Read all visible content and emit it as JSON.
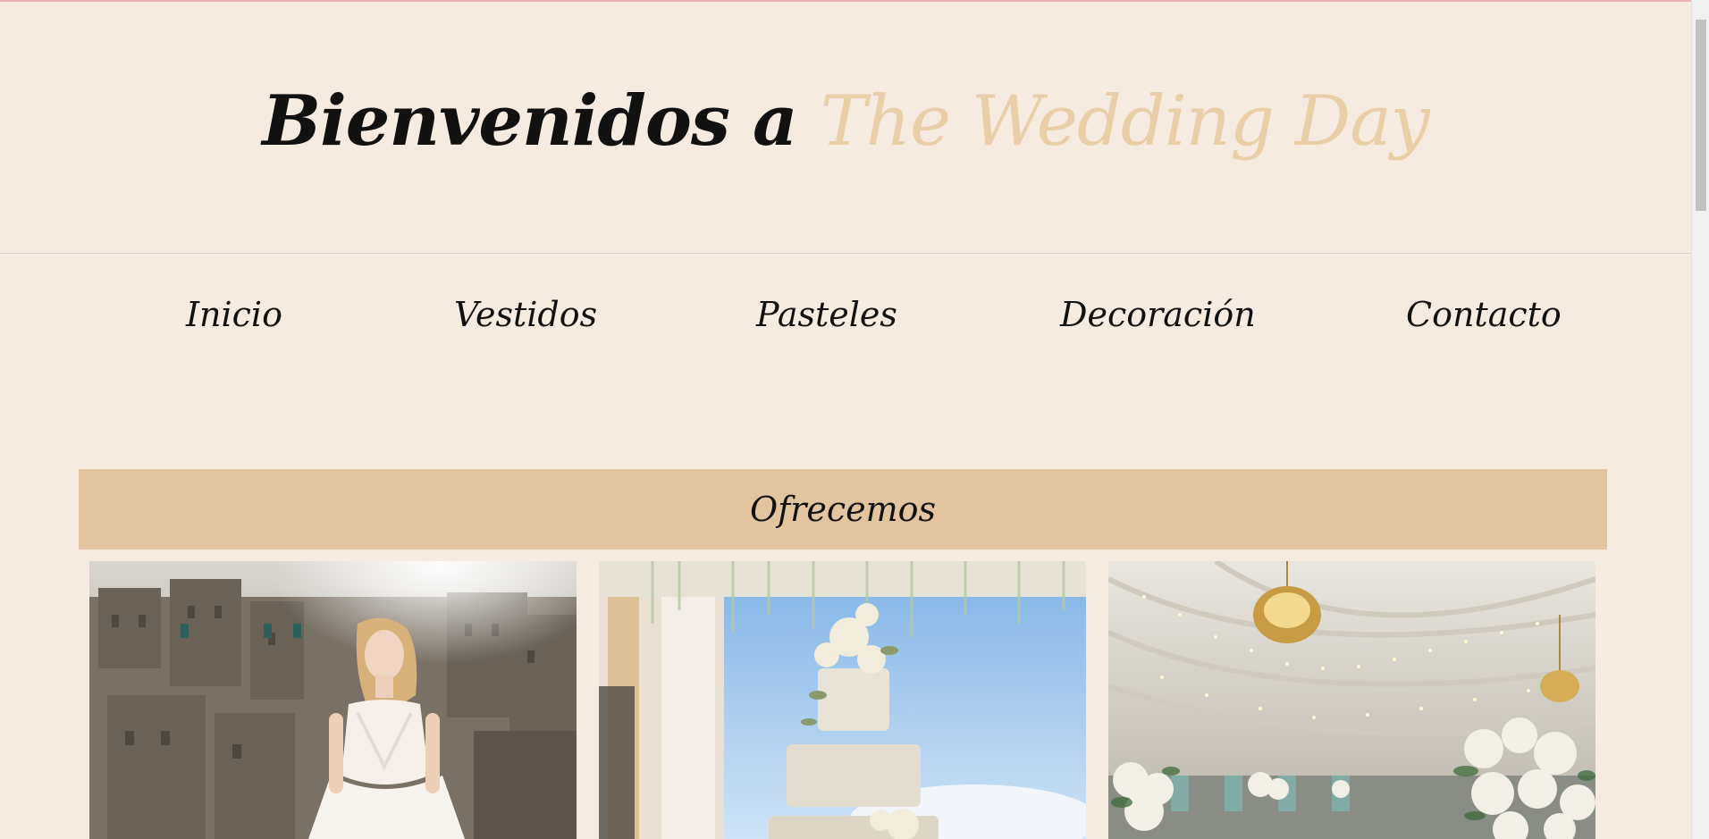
{
  "hero": {
    "title_prefix": "Bienvenidos a",
    "title_brand": "The Wedding Day"
  },
  "nav": {
    "items": [
      {
        "label": "Inicio"
      },
      {
        "label": "Vestidos"
      },
      {
        "label": "Pasteles"
      },
      {
        "label": "Decoración"
      },
      {
        "label": "Contacto"
      }
    ]
  },
  "section": {
    "title": "Ofrecemos"
  },
  "cards": [
    {
      "image": "wedding-dress-photo"
    },
    {
      "image": "wedding-cake-photo"
    },
    {
      "image": "reception-decoration-photo"
    }
  ],
  "colors": {
    "background": "#f5ebe1",
    "brand": "#e8cfa7",
    "section_bar": "#e2c49f",
    "text": "#111111"
  }
}
